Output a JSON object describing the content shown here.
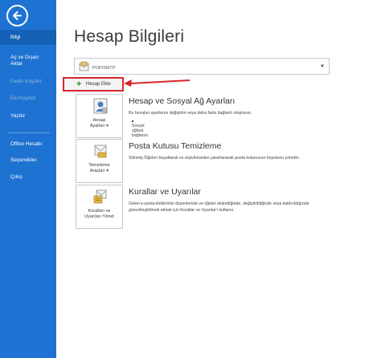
{
  "sidebar": {
    "items": [
      {
        "label": "Bilgi",
        "state": "active"
      },
      {
        "label": "Aç ve Dışarı",
        "label2": "Aktar",
        "state": "normal"
      },
      {
        "label": "Farklı Kaydet",
        "state": "disabled"
      },
      {
        "label": "Eki Kaydet",
        "state": "disabled"
      },
      {
        "label": "Yazdır",
        "state": "normal"
      },
      {
        "label": "Office Hesabı",
        "state": "normal"
      },
      {
        "label": "Seçenekler",
        "state": "normal"
      },
      {
        "label": "Çıkış",
        "state": "normal"
      }
    ]
  },
  "main": {
    "title": "Hesap Bilgileri",
    "account_select": {
      "value": "POP/SMTP"
    },
    "add_account": {
      "label": "Hesap Ekle"
    },
    "sections": [
      {
        "tile_line1": "Hesap",
        "tile_line2": "Ayarları",
        "title": "Hesap ve Sosyal Ağ Ayarları",
        "desc": "Bu hesabın ayarlarını değiştirin veya daha fazla bağlantı oluşturun.",
        "bullet": "Sosyal ağlara bağlanın."
      },
      {
        "tile_line1": "Temizleme",
        "tile_line2": "Araçları",
        "title": "Posta Kutusu Temizleme",
        "desc": "Silinmiş Öğeleri boşaltarak ve arşivlemeden yararlanarak posta kutunuzun boyutunu yönetin."
      },
      {
        "tile_line1": "Kuralları ve",
        "tile_line2": "Uyarıları Yönet",
        "title": "Kurallar ve Uyarılar",
        "desc": "Gelen e-posta iletilerinizi düzenlemek ve öğeler eklendiğinde, değiştirildiğinde veya kaldırıldığında güncelleştirilmek almak için Kurallar ve Uyarılar'ı kullanın."
      }
    ]
  },
  "colors": {
    "sidebar": "#1e73d2",
    "sidebar_active": "#1561b5",
    "highlight": "#d9262b"
  },
  "icons": [
    "back-arrow-icon",
    "account-icon",
    "plus-icon",
    "account-settings-icon",
    "cleanup-tools-icon",
    "rules-alerts-icon"
  ]
}
